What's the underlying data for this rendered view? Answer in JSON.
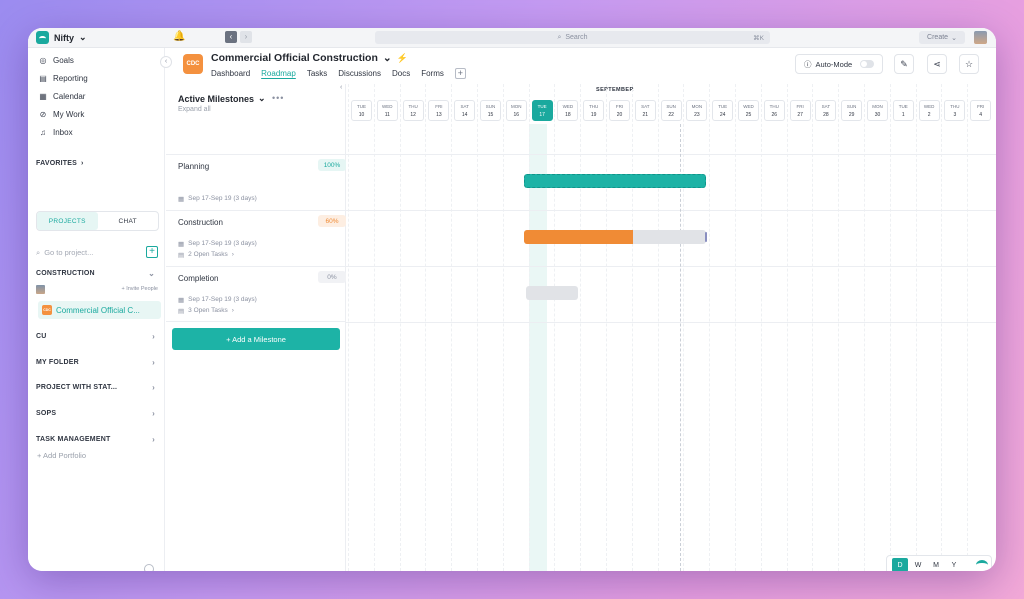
{
  "topbar": {
    "brand": "Nifty",
    "search_placeholder": "Search",
    "search_shortcut": "⌘K",
    "create_label": "Create"
  },
  "sidebar": {
    "nav": [
      {
        "label": "Goals",
        "icon": "goals-icon"
      },
      {
        "label": "Reporting",
        "icon": "reporting-icon"
      },
      {
        "label": "Calendar",
        "icon": "calendar-icon"
      },
      {
        "label": "My Work",
        "icon": "my-work-icon"
      },
      {
        "label": "Inbox",
        "icon": "inbox-icon"
      }
    ],
    "favorites": "FAVORITES",
    "tabs": {
      "projects": "PROJECTS",
      "chat": "CHAT"
    },
    "goto_placeholder": "Go to project...",
    "groups": {
      "construction": "CONSTRUCTION",
      "invite": "+ Invite People",
      "active_project": "Commercial Official C...",
      "cu": "CU",
      "my_folder": "MY FOLDER",
      "project_with_stat": "PROJECT WITH STAT...",
      "sops": "SOPS",
      "task_management": "TASK MANAGEMENT"
    },
    "add_portfolio": "+ Add Portfolio"
  },
  "project": {
    "badge": "CDC",
    "title": "Commercial Official Construction",
    "tabs": [
      "Dashboard",
      "Roadmap",
      "Tasks",
      "Discussions",
      "Docs",
      "Forms"
    ],
    "active_tab": "Roadmap",
    "auto_mode": "Auto-Mode"
  },
  "milestones": {
    "header": "Active Milestones",
    "expand_all": "Expand all",
    "items": [
      {
        "name": "Planning",
        "percent": "100%",
        "dates": "Sep 17-Sep 19 (3 days)",
        "open_tasks": ""
      },
      {
        "name": "Construction",
        "percent": "60%",
        "dates": "Sep 17-Sep 19 (3 days)",
        "open_tasks": "2 Open Tasks"
      },
      {
        "name": "Completion",
        "percent": "0%",
        "dates": "Sep 17-Sep 19 (3 days)",
        "open_tasks": "3 Open Tasks"
      }
    ],
    "add_button": "+ Add a Milestone",
    "colors": {
      "done": "#1aa99e",
      "partial": "#f08b35",
      "none": "#8a90a0"
    }
  },
  "timeline": {
    "month": "SEPTEMBER",
    "days": [
      {
        "dow": "TUE",
        "day": "10"
      },
      {
        "dow": "WED",
        "day": "11"
      },
      {
        "dow": "THU",
        "day": "12"
      },
      {
        "dow": "FRI",
        "day": "13"
      },
      {
        "dow": "SAT",
        "day": "14"
      },
      {
        "dow": "SUN",
        "day": "15"
      },
      {
        "dow": "MON",
        "day": "16"
      },
      {
        "dow": "TUE",
        "day": "17"
      },
      {
        "dow": "WED",
        "day": "18"
      },
      {
        "dow": "THU",
        "day": "19"
      },
      {
        "dow": "FRI",
        "day": "20"
      },
      {
        "dow": "SAT",
        "day": "21"
      },
      {
        "dow": "SUN",
        "day": "22"
      },
      {
        "dow": "MON",
        "day": "23"
      },
      {
        "dow": "TUE",
        "day": "24"
      },
      {
        "dow": "WED",
        "day": "25"
      },
      {
        "dow": "THU",
        "day": "26"
      },
      {
        "dow": "FRI",
        "day": "27"
      },
      {
        "dow": "SAT",
        "day": "28"
      },
      {
        "dow": "SUN",
        "day": "29"
      },
      {
        "dow": "MON",
        "day": "30"
      },
      {
        "dow": "TUE",
        "day": "1"
      },
      {
        "dow": "WED",
        "day": "2"
      },
      {
        "dow": "THU",
        "day": "3"
      },
      {
        "dow": "FRI",
        "day": "4"
      }
    ],
    "today": "17",
    "view_modes": [
      "D",
      "W",
      "M",
      "Y"
    ],
    "active_view": "D",
    "progress": {
      "planning": 1.0,
      "construction": 0.6,
      "completion": 0.0
    },
    "accent": "#1aa99e"
  }
}
